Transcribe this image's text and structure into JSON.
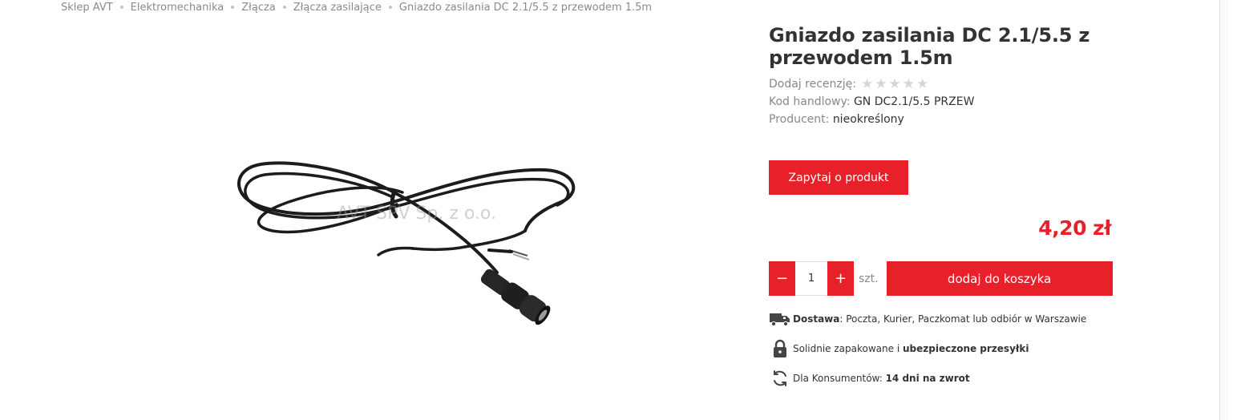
{
  "breadcrumb": {
    "items": [
      "Sklep AVT",
      "Elektromechanika",
      "Złącza",
      "Złącza zasilające",
      "Gniazdo zasilania DC 2.1/5.5 z przewodem 1.5m"
    ]
  },
  "image": {
    "watermark": "AVT SPV Sp. z o.o."
  },
  "product": {
    "title": "Gniazdo zasilania DC 2.1/5.5 z przewodem 1.5m",
    "review_label": "Dodaj recenzję:",
    "rating": 0,
    "rating_max": 5,
    "code_label": "Kod handlowy:",
    "code_value": "GN DC2.1/5.5 PRZEW",
    "producer_label": "Producent:",
    "producer_value": "nieokreślony",
    "ask_button": "Zapytaj o produkt",
    "price": "4,20 zł"
  },
  "cart": {
    "minus": "−",
    "plus": "+",
    "quantity": "1",
    "unit": "szt.",
    "add_button": "dodaj do koszyka"
  },
  "features": {
    "delivery_bold": "Dostawa",
    "delivery_text": ": Poczta, Kurier, Paczkomat lub odbiór w Warszawie",
    "packing_text": "Solidnie zapakowane i ",
    "packing_bold": "ubezpieczone przesyłki",
    "return_text": "Dla Konsumentów: ",
    "return_bold": "14 dni na zwrot"
  },
  "icons": [
    "truck-icon",
    "lock-icon",
    "return-arrows-icon",
    "star-icon"
  ],
  "colors": {
    "accent": "#e8202a",
    "text": "#333333",
    "muted": "#888888",
    "star_empty": "#d6d6d6"
  }
}
